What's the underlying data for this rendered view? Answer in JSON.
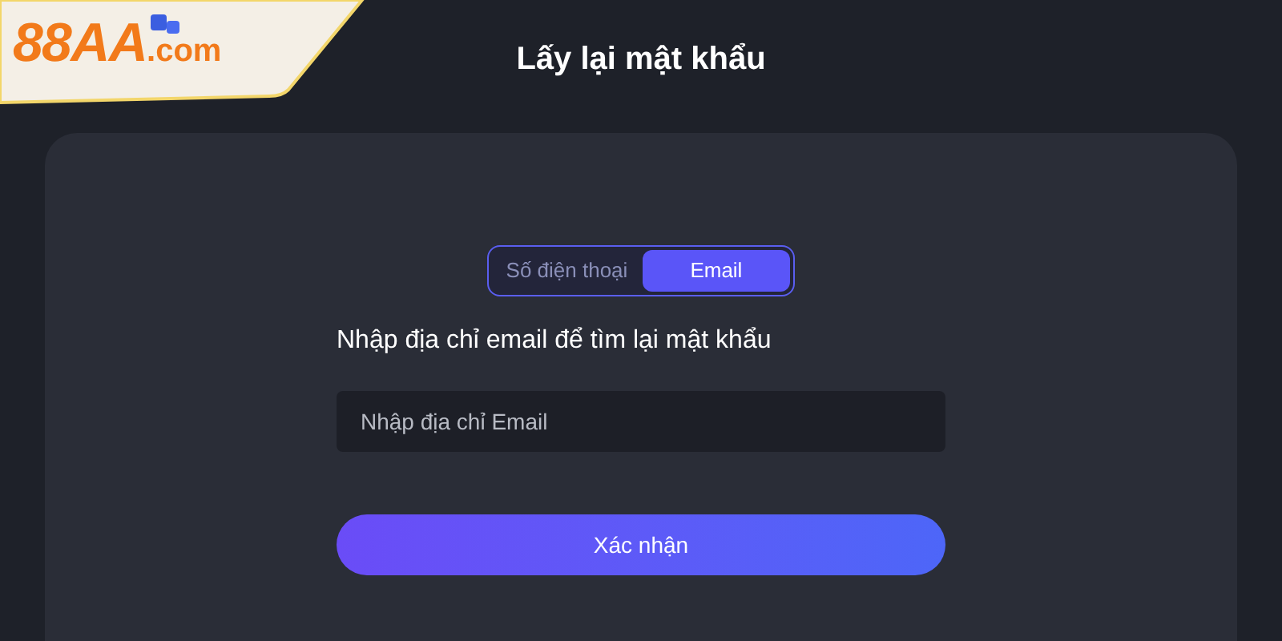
{
  "logo": {
    "text_a": "88AA",
    "text_b": ".com"
  },
  "title": "Lấy lại mật khẩu",
  "tabs": [
    {
      "label": "Số điện thoại",
      "selected": false
    },
    {
      "label": "Email",
      "selected": true
    }
  ],
  "instruction": "Nhập địa chỉ email để tìm lại mật khẩu",
  "email_field": {
    "placeholder": "Nhập địa chỉ Email"
  },
  "submit_button": "Xác nhận"
}
